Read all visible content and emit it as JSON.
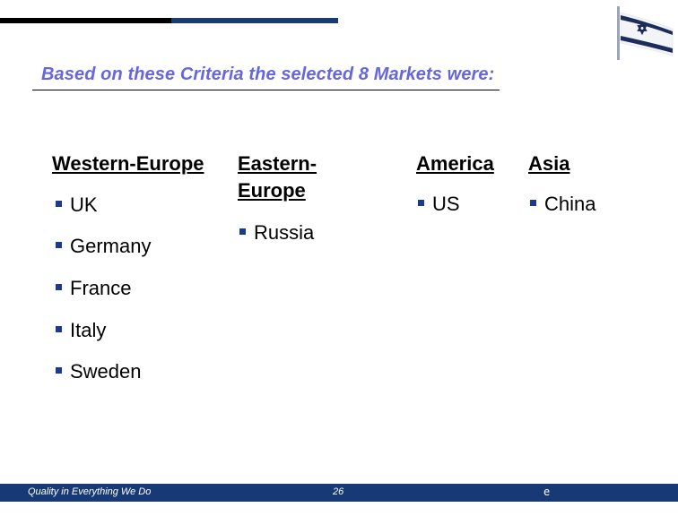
{
  "slide": {
    "title": "Based on these Criteria the selected 8 Markets were:",
    "flag_icon": "israel-flag-icon",
    "columns": [
      {
        "heading": "Western-Europe",
        "items": [
          "UK",
          "Germany",
          "France",
          "Italy",
          "Sweden"
        ]
      },
      {
        "heading_line1": "Eastern-",
        "heading_line2": "Europe",
        "items": [
          "Russia"
        ]
      },
      {
        "heading": "America",
        "items": [
          "US"
        ]
      },
      {
        "heading": "Asia",
        "items": [
          "China"
        ]
      }
    ],
    "bullet_icon": "square-bullet-icon"
  },
  "footer": {
    "tagline": "Quality in Everything We Do",
    "page_number": "26",
    "mark": "e"
  },
  "colors": {
    "title": "#6666dd",
    "accent_blue": "#1a3a74",
    "footer_bg": "#173a76",
    "bullet": "#1a3a8c"
  }
}
